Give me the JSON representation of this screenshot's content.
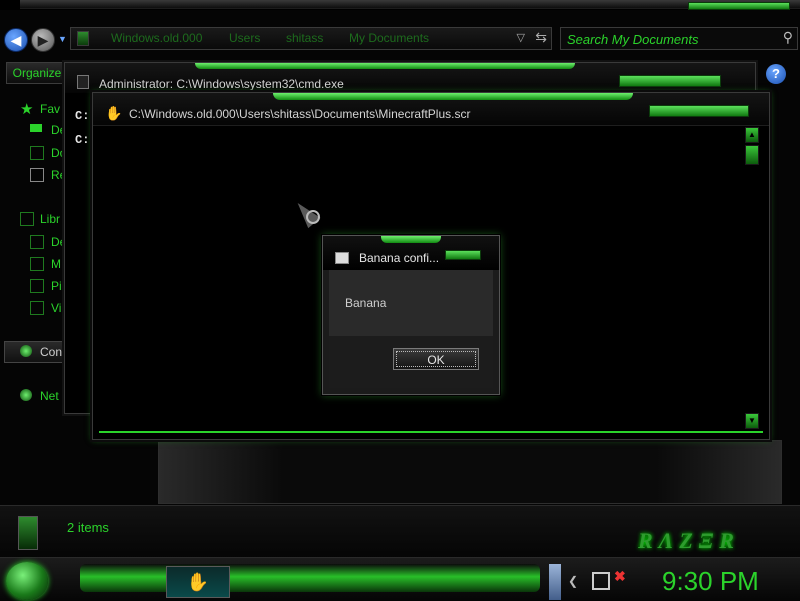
{
  "explorer": {
    "breadcrumb": [
      "Windows.old.000",
      "Users",
      "shitass",
      "My Documents"
    ],
    "search_placeholder": "Search My Documents",
    "organize_label": "Organize",
    "nav": {
      "favorites": "Fav",
      "fav_items": [
        "De",
        "Do",
        "Re"
      ],
      "libraries": "Libr",
      "lib_items": [
        "De",
        "M",
        "Pi",
        "Vi"
      ],
      "computer": "Con",
      "network": "Net"
    },
    "status": "2 items",
    "logo_text": "RAZER"
  },
  "cmd_window": {
    "title": "Administrator: C:\\Windows\\system32\\cmd.exe",
    "lines": [
      "C:\\",
      "C:\\"
    ]
  },
  "screensaver_window": {
    "title": "C:\\Windows.old.000\\Users\\shitass\\Documents\\MinecraftPlus.scr"
  },
  "dialog": {
    "title": "Banana confi...",
    "message": "Banana",
    "ok_label": "OK"
  },
  "taskbar": {
    "clock": "9:30 PM"
  },
  "colors": {
    "accent_green": "#2bd32b",
    "window_bg": "#000000",
    "dialog_bg": "#2a2a2a"
  }
}
